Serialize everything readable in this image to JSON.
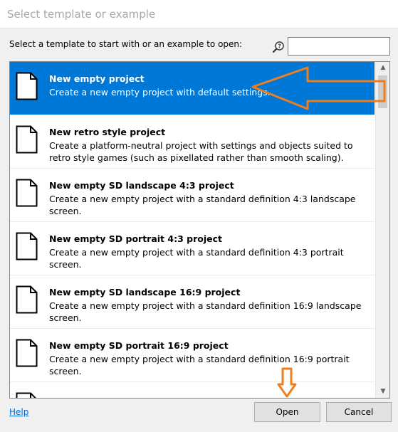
{
  "window": {
    "title": "Select template or example"
  },
  "prompt": "Select a template to start with or an example to open:",
  "search": {
    "value": "",
    "placeholder": ""
  },
  "templates": [
    {
      "name": "New empty project",
      "description": "Create a new empty project with default settings.",
      "selected": true
    },
    {
      "name": "New retro style project",
      "description": "Create a platform-neutral project with settings and objects suited to retro style games (such as pixellated rather than smooth scaling).",
      "selected": false
    },
    {
      "name": "New empty SD landscape 4:3 project",
      "description": "Create a new empty project with a standard definition 4:3 landscape screen.",
      "selected": false
    },
    {
      "name": "New empty SD portrait 4:3 project",
      "description": "Create a new empty project with a standard definition 4:3 portrait screen.",
      "selected": false
    },
    {
      "name": "New empty SD landscape 16:9 project",
      "description": "Create a new empty project with a standard definition 16:9 landscape screen.",
      "selected": false
    },
    {
      "name": "New empty SD portrait 16:9 project",
      "description": "Create a new empty project with a standard definition 16:9 portrait screen.",
      "selected": false
    }
  ],
  "footer": {
    "help_label": "Help",
    "open_label": "Open",
    "cancel_label": "Cancel"
  },
  "colors": {
    "selection": "#0078d7",
    "annotation": "#f07d1e",
    "link": "#0066cc"
  },
  "icons": {
    "search": "search-help-icon",
    "template": "document-icon"
  }
}
